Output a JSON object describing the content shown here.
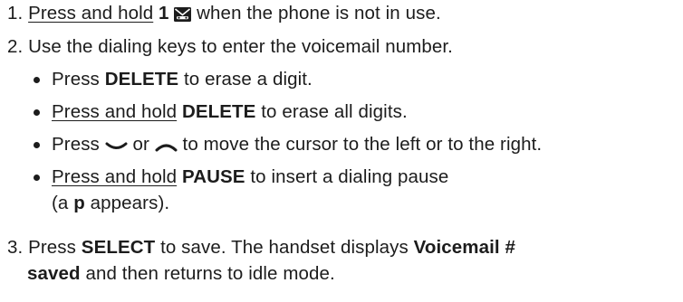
{
  "steps": [
    {
      "number": "1.",
      "press_hold": "Press and hold",
      "key": "1",
      "icon": "voicemail-envelope-icon",
      "text": "when the phone is not in use."
    },
    {
      "number": "2.",
      "text": "Use the dialing keys to enter the voicemail number.",
      "bullets": [
        {
          "pre": "Press",
          "key": "DELETE",
          "post": "to erase a digit."
        },
        {
          "press_hold": "Press and hold",
          "key": "DELETE",
          "post": "to erase all digits."
        },
        {
          "pre": "Press",
          "icon_down": "chevron-down-icon",
          "mid": "or",
          "icon_up": "chevron-up-icon",
          "post": "to move the cursor to the left or to the right."
        },
        {
          "press_hold": "Press and hold",
          "key": "PAUSE",
          "post": "to insert a dialing pause",
          "line2_pre": "(a",
          "line2_key": "p",
          "line2_post": "appears)."
        }
      ]
    },
    {
      "number": "3.",
      "pre": "Press",
      "key": "SELECT",
      "mid": "to save. The handset displays",
      "display_1": "Voicemail #",
      "display_2": "saved",
      "post": "and then returns to idle mode."
    }
  ]
}
